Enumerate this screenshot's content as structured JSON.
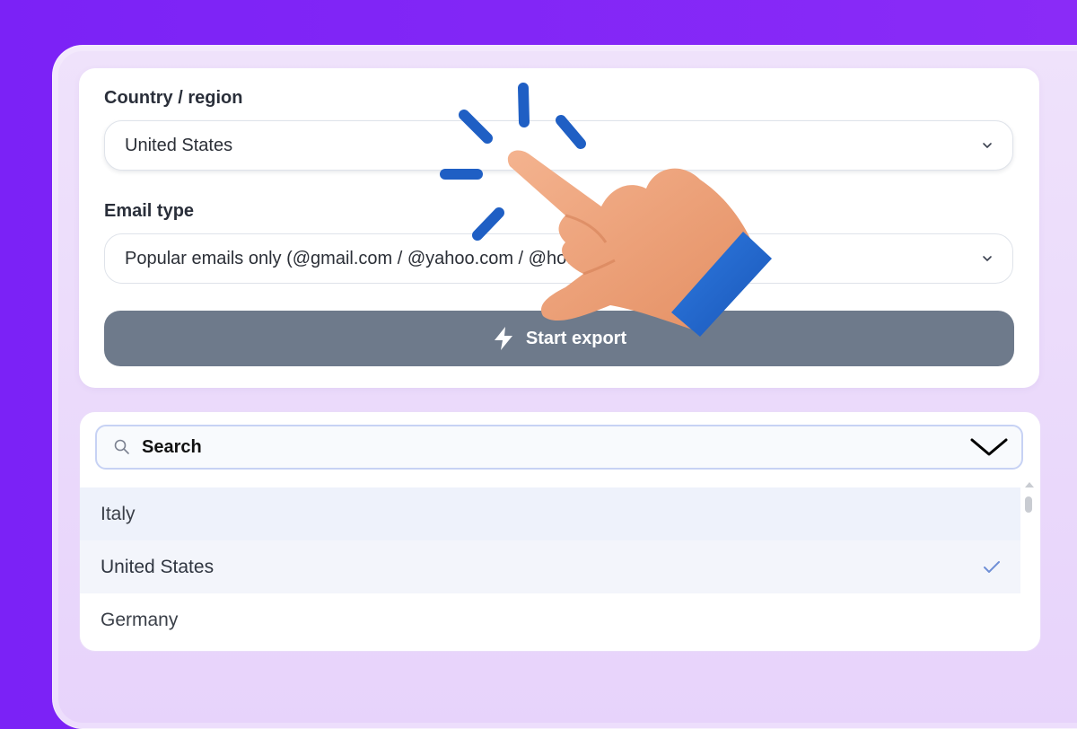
{
  "form": {
    "country_label": "Country / region",
    "country_value": "United States",
    "email_type_label": "Email type",
    "email_type_value": "Popular emails only (@gmail.com / @yahoo.com / @hotmail.com)",
    "export_button": "Start export"
  },
  "dropdown": {
    "search_placeholder": "Search",
    "options": [
      {
        "label": "Italy",
        "state": "hover"
      },
      {
        "label": "United States",
        "state": "selected"
      },
      {
        "label": "Germany",
        "state": "normal"
      }
    ]
  },
  "colors": {
    "background": "#7b22f6",
    "panel": "#ebdcfb",
    "export_button": "#6e7a8b",
    "check": "#6f8fd6"
  },
  "icons": {
    "chevron": "chevron-down-icon",
    "bolt": "bolt-icon",
    "search": "search-icon",
    "check": "check-icon",
    "hand": "pointing-hand-icon"
  }
}
